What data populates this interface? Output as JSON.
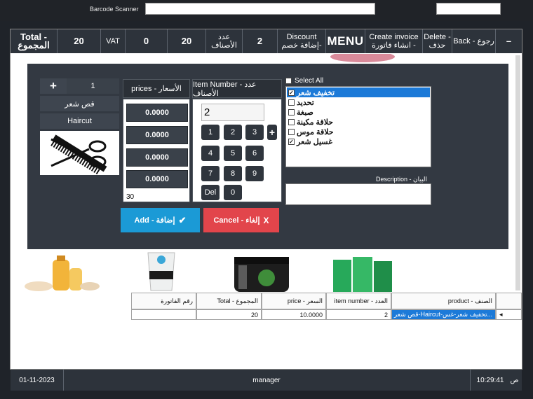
{
  "top_bar": {
    "scanner_label": "Barcode Scanner",
    "scanner_value": "",
    "right_value": ""
  },
  "header": {
    "total_label": "Total - المجموع",
    "total_value": "20",
    "vat_label": "VAT",
    "vat_value": "0",
    "items_value": "20",
    "items_label": "عدد الأصناف",
    "discount_value": "2",
    "discount_label": "Discount إضافة خصم-",
    "menu_label": "MENU",
    "create_invoice_label": "Create invoice انشاء فاتورة -",
    "delete_label": "Delete - حذف",
    "back_label": "Back - رجوع",
    "minimize_label": "–"
  },
  "dialog": {
    "quantity_plus": "+",
    "quantity": "1",
    "product_name_ar": "قص شعر",
    "product_name_en": "Haircut",
    "product_icon": "scissors-comb-icon",
    "prices_header": "prices - الأسعار",
    "prices": [
      "0.0000",
      "0.0000",
      "0.0000",
      "0.0000"
    ],
    "prices_footer": "30",
    "item_number_header": "Item Number - عدد الأصناف",
    "item_number_value": "2",
    "keys": [
      "1",
      "2",
      "3",
      "+",
      "4",
      "5",
      "6",
      "7",
      "8",
      "9",
      "Del",
      "0"
    ],
    "select_all_label": "Select All",
    "categories": [
      {
        "label": "تخفيف شعر",
        "checked": true,
        "selected": true
      },
      {
        "label": "تحديد",
        "checked": false,
        "selected": false
      },
      {
        "label": "صبغة",
        "checked": false,
        "selected": false
      },
      {
        "label": "حلاقة مكينة",
        "checked": false,
        "selected": false
      },
      {
        "label": "حلاقة موس",
        "checked": false,
        "selected": false
      },
      {
        "label": "غسيل شعر",
        "checked": true,
        "selected": false
      }
    ],
    "description_label": "Description - البيان",
    "description_value": "",
    "add_button": "Add - إضافة",
    "add_icon": "check-icon",
    "cancel_button": "Cancel - إلغاء",
    "cancel_icon": "x-icon"
  },
  "grid": {
    "columns": [
      "رقم الفاتورة",
      "Total - المجموع",
      "price - السعر",
      "item number - العدد",
      "product - الصنف"
    ],
    "rows": [
      {
        "invoice": "",
        "total": "20",
        "price": "10.0000",
        "count": "2",
        "product": "قص شعر-Haircut-تخفيف شعر-غس..."
      }
    ]
  },
  "status_bar": {
    "date": "01-11-2023",
    "user": "manager",
    "time": "10:29:41",
    "period": "ص"
  },
  "colors": {
    "accent_blue": "#1b9ad6",
    "danger_red": "#e2454b",
    "dark_panel": "#2d333b",
    "selection": "#1c7ad8"
  }
}
